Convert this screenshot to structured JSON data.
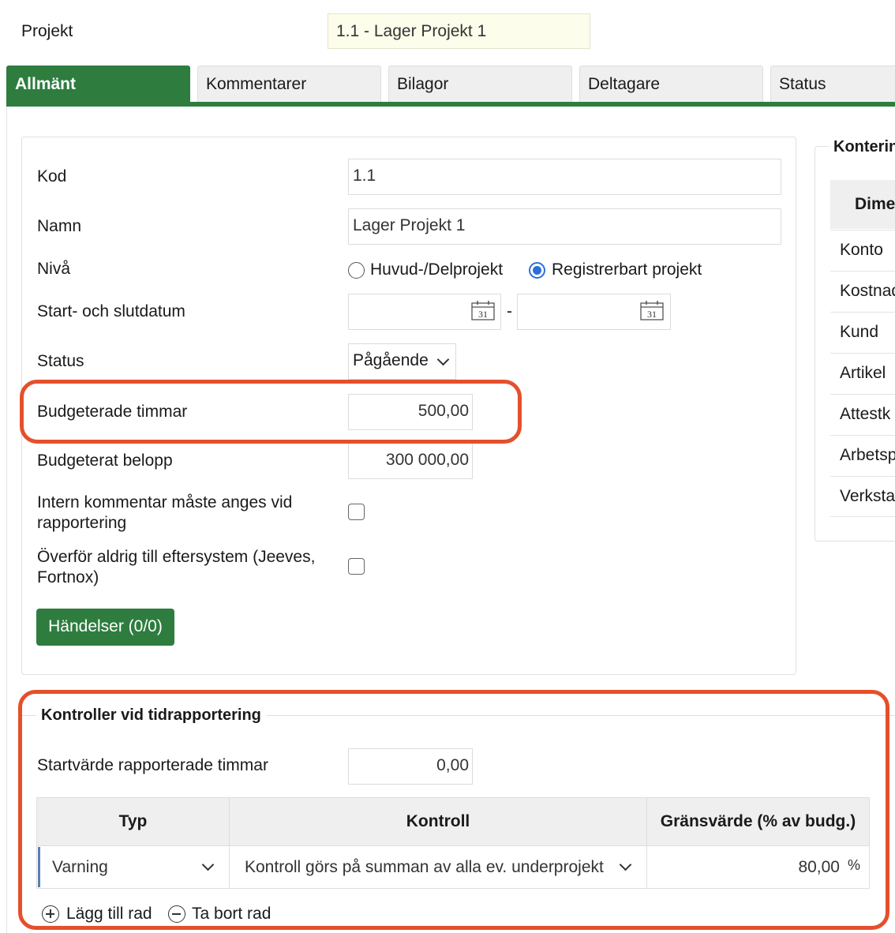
{
  "header": {
    "project_label": "Projekt",
    "project_value": "1.1 - Lager Projekt 1"
  },
  "tabs": [
    {
      "label": "Allmänt",
      "active": true
    },
    {
      "label": "Kommentarer",
      "active": false
    },
    {
      "label": "Bilagor",
      "active": false
    },
    {
      "label": "Deltagare",
      "active": false
    },
    {
      "label": "Status",
      "active": false
    }
  ],
  "form": {
    "kod_label": "Kod",
    "kod_value": "1.1",
    "namn_label": "Namn",
    "namn_value": "Lager Projekt 1",
    "niva_label": "Nivå",
    "niva_option_1": "Huvud-/Delprojekt",
    "niva_option_2": "Registrerbart projekt",
    "niva_selected": "Registrerbart projekt",
    "datum_label": "Start- och slutdatum",
    "datum_separator": "-",
    "datum_start": "",
    "datum_end": "",
    "calendar_icon_text": "31",
    "status_label": "Status",
    "status_value": "Pågående",
    "budget_timmar_label": "Budgeterade timmar",
    "budget_timmar_value": "500,00",
    "budget_belopp_label": "Budgeterat belopp",
    "budget_belopp_value": "300 000,00",
    "intern_kommentar_label_line1": "Intern kommentar måste anges vid",
    "intern_kommentar_label_line2": "rapportering",
    "intern_kommentar_checked": false,
    "overfor_label_line1": "Överför aldrig till eftersystem (Jeeves,",
    "overfor_label_line2": "Fortnox)",
    "overfor_checked": false,
    "handelser_button": "Händelser (0/0)"
  },
  "kontering": {
    "title": "Konterin",
    "column_header": "Dime",
    "rows": [
      "Konto",
      "Kostnad",
      "Kund",
      "Artikel",
      "Attestk",
      "Arbetsp",
      "Verksta"
    ]
  },
  "kontroller": {
    "title": "Kontroller vid tidrapportering",
    "startvarde_label": "Startvärde rapporterade timmar",
    "startvarde_value": "0,00",
    "columns": [
      "Typ",
      "Kontroll",
      "Gränsvärde (% av budg.)"
    ],
    "row": {
      "typ": "Varning",
      "kontroll": "Kontroll görs på summan av alla ev. underprojekt",
      "gransvarde": "80,00",
      "unit": "%"
    },
    "add_row": "Lägg till rad",
    "remove_row": "Ta bort rad"
  },
  "colors": {
    "accent_green": "#2e7d3f",
    "highlight_red": "#e4502c",
    "radio_blue": "#2a6fdb",
    "project_field_bg": "#fdfdec"
  }
}
